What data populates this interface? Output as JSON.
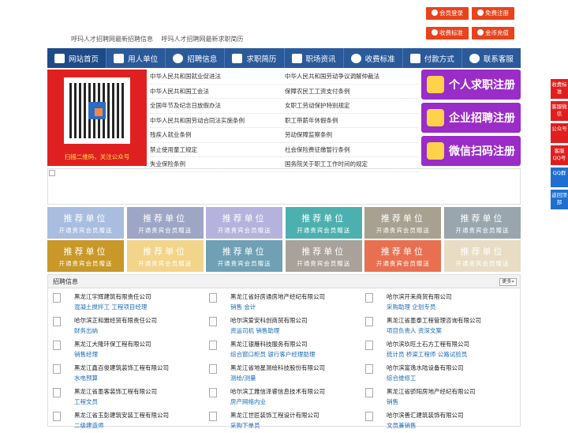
{
  "top_buttons": [
    {
      "label": "会员登录",
      "icon": "user-icon"
    },
    {
      "label": "免费注册",
      "icon": "user-add-icon"
    },
    {
      "label": "收费标准",
      "icon": "check-icon"
    },
    {
      "label": "金币充值",
      "icon": "coin-icon"
    }
  ],
  "tagline": [
    "呼玛人才招聘网最新招聘信息",
    "呼玛人才招聘网最新求职简历"
  ],
  "nav": [
    {
      "label": "网站首页",
      "icon": "home-icon"
    },
    {
      "label": "用人单位",
      "icon": "building-icon"
    },
    {
      "label": "招聘信息",
      "icon": "megaphone-icon"
    },
    {
      "label": "求职简历",
      "icon": "resume-icon"
    },
    {
      "label": "职场资讯",
      "icon": "news-icon"
    },
    {
      "label": "收费标准",
      "icon": "check-icon"
    },
    {
      "label": "付款方式",
      "icon": "payment-icon"
    },
    {
      "label": "联系客服",
      "icon": "phone-icon"
    }
  ],
  "qr_caption": "扫描二维码，关注公众号",
  "law_links": [
    [
      "中华人民共和国就业促进法",
      "中华人民共和国劳动争议调解仲裁法"
    ],
    [
      "中华人民共和国工会法",
      "保障农民工工资支付条例"
    ],
    [
      "全国年节及纪念日放假办法",
      "女职工劳动保护特别规定"
    ],
    [
      "中华人民共和国劳动合同法实施条例",
      "职工带薪年休假条例"
    ],
    [
      "残疾人就业条例",
      "劳动保障监察条例"
    ],
    [
      "禁止使用童工规定",
      "社会保险费征缴暂行条例"
    ],
    [
      "失业保险条例",
      "国务院关于职工工作时间的规定"
    ]
  ],
  "register_buttons": [
    {
      "label": "个人求职注册",
      "icon": "person-icon"
    },
    {
      "label": "企业招聘注册",
      "icon": "company-icon"
    },
    {
      "label": "微信扫码注册",
      "icon": "wechat-icon"
    }
  ],
  "side_float": [
    "收费标准",
    "客服微信",
    "公众号",
    "客服QQ号",
    "QQ群",
    "返回顶部"
  ],
  "ad_slot": {
    "title": "推荐单位",
    "sub": "开通贵宾会员赠送"
  },
  "ad_colors": [
    "#a9bde0",
    "#9ea6c6",
    "#b6b2de",
    "#4db0b0",
    "#a8a090",
    "#9aa6ae",
    "#c89828",
    "#f2d48a",
    "#6fa0b4",
    "#a8a29a",
    "#e87050",
    "#e8dcc4"
  ],
  "jobs_title": "招聘信息",
  "jobs_more": "更多»",
  "jobs": [
    {
      "company": "黑龙江宇辉建筑有限责任公司",
      "positions": "混凝土搅拌工 工程项目经理"
    },
    {
      "company": "黑龙江省好房通房地产经纪有限公司",
      "positions": "销售 会计"
    },
    {
      "company": "哈尔滨开来商贸有限公司",
      "positions": "采购助理 企划专员"
    },
    {
      "company": "哈尔滨正和雅经贸有限责任公司",
      "positions": "财务出纳"
    },
    {
      "company": "哈尔滨爱安科创商贸有限公司",
      "positions": "资运司机 销售助理"
    },
    {
      "company": "黑龙江省墨泰工程管理咨询有限公司",
      "positions": "项目负责人 资深文案"
    },
    {
      "company": "黑龙江大隆环保工程有限公司",
      "positions": "销售经理"
    },
    {
      "company": "黑龙江银雁科技服务有限公司",
      "positions": "综合窗口柜员 银行客户经理助理"
    },
    {
      "company": "哈尔滨玖旺土石方工程有限公司",
      "positions": "统计员 桥梁工程师 公路试验员"
    },
    {
      "company": "黑龙江鑫百俊建筑装饰工程有限公司",
      "positions": "水电预算"
    },
    {
      "company": "黑龙江省地星测绘科技股份有限公司",
      "positions": "测绘/测量"
    },
    {
      "company": "哈尔滨富逸水陆设备有限公司",
      "positions": "综合维修工"
    },
    {
      "company": "黑龙江省墨客装饰工程有限公司",
      "positions": "工程文员"
    },
    {
      "company": "哈尔滨工雅信泽睿信息技术有限公司",
      "positions": "房产网络内业"
    },
    {
      "company": "黑龙江省骄阳房地产经纪有限公司",
      "positions": "销售"
    },
    {
      "company": "黑龙江省玉彭建筑安装工程有限公司",
      "positions": "二级建造师"
    },
    {
      "company": "黑龙江世匠装饰工程设计有限公司",
      "positions": "采购下单员"
    },
    {
      "company": "哈尔滨善汇建筑装饰有限公司",
      "positions": "文员兼销售"
    }
  ]
}
